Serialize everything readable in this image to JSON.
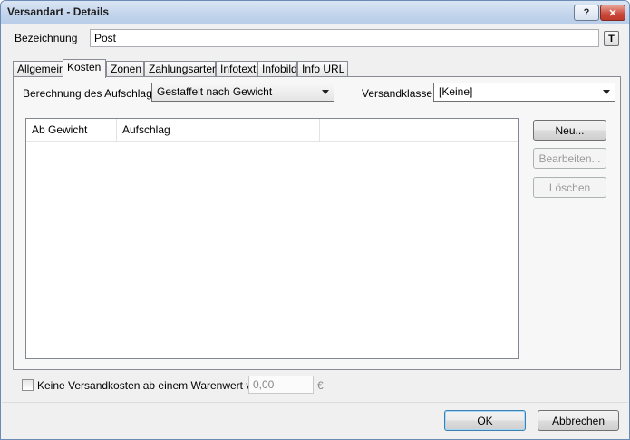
{
  "window": {
    "title": "Versandart - Details",
    "help_label": "?",
    "close_label": "✕"
  },
  "name_field": {
    "label": "Bezeichnung",
    "value": "Post",
    "translate_button_label": "T"
  },
  "tabs": [
    {
      "label": "Allgemein",
      "active": false
    },
    {
      "label": "Kosten",
      "active": true
    },
    {
      "label": "Zonen",
      "active": false
    },
    {
      "label": "Zahlungsarten",
      "active": false
    },
    {
      "label": "Infotext",
      "active": false
    },
    {
      "label": "Infobild",
      "active": false
    },
    {
      "label": "Info URL",
      "active": false
    }
  ],
  "kosten": {
    "calc_label": "Berechnung des Aufschlags:",
    "calc_value": "Gestaffelt nach Gewicht",
    "class_label": "Versandklasse:",
    "class_value": "[Keine]",
    "table": {
      "columns": [
        "Ab Gewicht",
        "Aufschlag",
        ""
      ],
      "rows": []
    },
    "buttons": {
      "new": "Neu...",
      "edit": "Bearbeiten...",
      "delete": "Löschen"
    }
  },
  "free_shipping": {
    "checked": false,
    "label": "Keine Versandkosten ab einem Warenwert von",
    "value": "0,00",
    "currency": "€"
  },
  "footer": {
    "ok_label": "OK",
    "cancel_label": "Abbrechen"
  }
}
